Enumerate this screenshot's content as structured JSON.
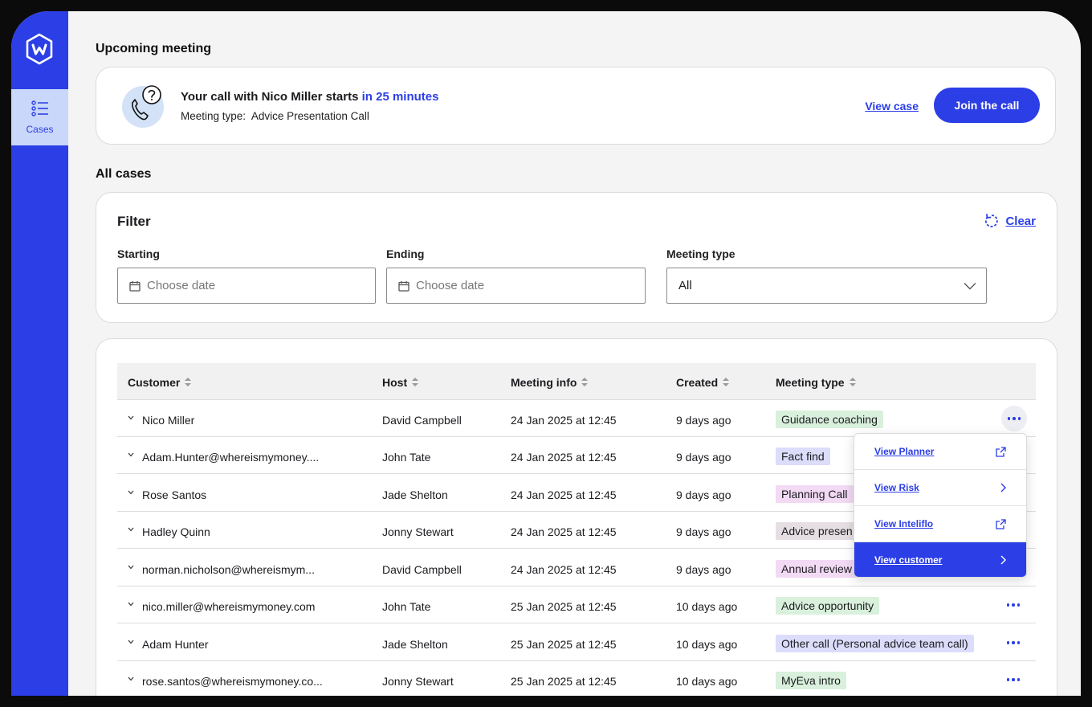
{
  "sidebar": {
    "logo_letter": "W",
    "nav": [
      {
        "label": "Cases",
        "icon": "list-icon",
        "active": true
      }
    ]
  },
  "upcoming": {
    "heading": "Upcoming meeting",
    "title_prefix": "Your call with Nico Miller starts",
    "title_highlight": "in 25 minutes",
    "meeting_type_label": "Meeting type:",
    "meeting_type_value": "Advice Presentation Call",
    "view_case": "View case",
    "join": "Join the call"
  },
  "all_cases": {
    "heading": "All cases",
    "filter": {
      "title": "Filter",
      "clear": "Clear",
      "starting_label": "Starting",
      "starting_placeholder": "Choose date",
      "ending_label": "Ending",
      "ending_placeholder": "Choose date",
      "meeting_type_label": "Meeting type",
      "meeting_type_value": "All"
    }
  },
  "table": {
    "columns": [
      "Customer",
      "Host",
      "Meeting info",
      "Created",
      "Meeting type"
    ],
    "rows": [
      {
        "customer": "Nico Miller",
        "host": "David Campbell",
        "info": "24 Jan 2025 at 12:45",
        "created": "9 days ago",
        "type": "Guidance coaching",
        "tag_color": "#d9f0dc"
      },
      {
        "customer": "Adam.Hunter@whereismymoney....",
        "host": "John Tate",
        "info": "24 Jan 2025 at 12:45",
        "created": "9 days ago",
        "type": "Fact find",
        "tag_color": "#dcdcfb"
      },
      {
        "customer": "Rose Santos",
        "host": "Jade Shelton",
        "info": "24 Jan 2025 at 12:45",
        "created": "9 days ago",
        "type": "Planning Call",
        "tag_color": "#f2d9f4"
      },
      {
        "customer": "Hadley Quinn",
        "host": "Jonny Stewart",
        "info": "24 Jan 2025 at 12:45",
        "created": "9 days ago",
        "type": "Advice presen",
        "tag_color": "#e5dfe3"
      },
      {
        "customer": "norman.nicholson@whereismym...",
        "host": "David Campbell",
        "info": "24 Jan 2025 at 12:45",
        "created": "9 days ago",
        "type": "Annual review",
        "tag_color": "#f2d9f4"
      },
      {
        "customer": "nico.miller@whereismymoney.com",
        "host": "John Tate",
        "info": "25 Jan 2025 at 12:45",
        "created": "10 days ago",
        "type": "Advice opportunity",
        "tag_color": "#d9f0dc"
      },
      {
        "customer": "Adam Hunter",
        "host": "Jade Shelton",
        "info": "25 Jan 2025 at 12:45",
        "created": "10 days ago",
        "type": "Other call (Personal advice team call)",
        "tag_color": "#dcdcfb"
      },
      {
        "customer": "rose.santos@whereismymoney.co...",
        "host": "Jonny Stewart",
        "info": "25 Jan 2025 at 12:45",
        "created": "10 days ago",
        "type": "MyEva intro",
        "tag_color": "#d9f0dc"
      }
    ]
  },
  "menu": {
    "items": [
      {
        "label": "View Planner",
        "icon": "external-link-icon"
      },
      {
        "label": "View Risk",
        "icon": "chevron-right-icon"
      },
      {
        "label": "View Inteliflo",
        "icon": "external-link-icon"
      },
      {
        "label": "View customer",
        "icon": "chevron-right-icon",
        "selected": true
      }
    ]
  },
  "colors": {
    "accent": "#2c3ee6",
    "nav_active_bg": "#c9d7fb"
  }
}
